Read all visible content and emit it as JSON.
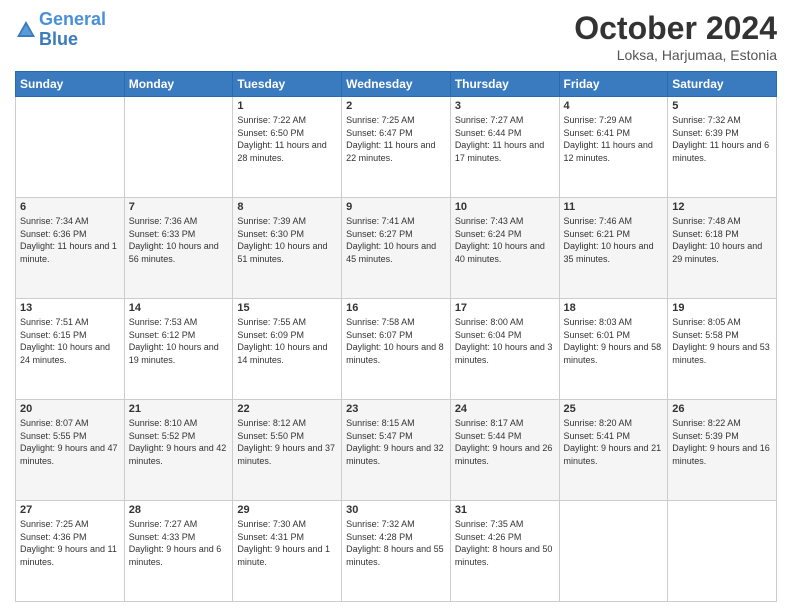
{
  "header": {
    "logo_line1": "General",
    "logo_line2": "Blue",
    "month": "October 2024",
    "location": "Loksa, Harjumaa, Estonia"
  },
  "weekdays": [
    "Sunday",
    "Monday",
    "Tuesday",
    "Wednesday",
    "Thursday",
    "Friday",
    "Saturday"
  ],
  "weeks": [
    [
      {
        "day": "",
        "content": ""
      },
      {
        "day": "",
        "content": ""
      },
      {
        "day": "1",
        "content": "Sunrise: 7:22 AM\nSunset: 6:50 PM\nDaylight: 11 hours and 28 minutes."
      },
      {
        "day": "2",
        "content": "Sunrise: 7:25 AM\nSunset: 6:47 PM\nDaylight: 11 hours and 22 minutes."
      },
      {
        "day": "3",
        "content": "Sunrise: 7:27 AM\nSunset: 6:44 PM\nDaylight: 11 hours and 17 minutes."
      },
      {
        "day": "4",
        "content": "Sunrise: 7:29 AM\nSunset: 6:41 PM\nDaylight: 11 hours and 12 minutes."
      },
      {
        "day": "5",
        "content": "Sunrise: 7:32 AM\nSunset: 6:39 PM\nDaylight: 11 hours and 6 minutes."
      }
    ],
    [
      {
        "day": "6",
        "content": "Sunrise: 7:34 AM\nSunset: 6:36 PM\nDaylight: 11 hours and 1 minute."
      },
      {
        "day": "7",
        "content": "Sunrise: 7:36 AM\nSunset: 6:33 PM\nDaylight: 10 hours and 56 minutes."
      },
      {
        "day": "8",
        "content": "Sunrise: 7:39 AM\nSunset: 6:30 PM\nDaylight: 10 hours and 51 minutes."
      },
      {
        "day": "9",
        "content": "Sunrise: 7:41 AM\nSunset: 6:27 PM\nDaylight: 10 hours and 45 minutes."
      },
      {
        "day": "10",
        "content": "Sunrise: 7:43 AM\nSunset: 6:24 PM\nDaylight: 10 hours and 40 minutes."
      },
      {
        "day": "11",
        "content": "Sunrise: 7:46 AM\nSunset: 6:21 PM\nDaylight: 10 hours and 35 minutes."
      },
      {
        "day": "12",
        "content": "Sunrise: 7:48 AM\nSunset: 6:18 PM\nDaylight: 10 hours and 29 minutes."
      }
    ],
    [
      {
        "day": "13",
        "content": "Sunrise: 7:51 AM\nSunset: 6:15 PM\nDaylight: 10 hours and 24 minutes."
      },
      {
        "day": "14",
        "content": "Sunrise: 7:53 AM\nSunset: 6:12 PM\nDaylight: 10 hours and 19 minutes."
      },
      {
        "day": "15",
        "content": "Sunrise: 7:55 AM\nSunset: 6:09 PM\nDaylight: 10 hours and 14 minutes."
      },
      {
        "day": "16",
        "content": "Sunrise: 7:58 AM\nSunset: 6:07 PM\nDaylight: 10 hours and 8 minutes."
      },
      {
        "day": "17",
        "content": "Sunrise: 8:00 AM\nSunset: 6:04 PM\nDaylight: 10 hours and 3 minutes."
      },
      {
        "day": "18",
        "content": "Sunrise: 8:03 AM\nSunset: 6:01 PM\nDaylight: 9 hours and 58 minutes."
      },
      {
        "day": "19",
        "content": "Sunrise: 8:05 AM\nSunset: 5:58 PM\nDaylight: 9 hours and 53 minutes."
      }
    ],
    [
      {
        "day": "20",
        "content": "Sunrise: 8:07 AM\nSunset: 5:55 PM\nDaylight: 9 hours and 47 minutes."
      },
      {
        "day": "21",
        "content": "Sunrise: 8:10 AM\nSunset: 5:52 PM\nDaylight: 9 hours and 42 minutes."
      },
      {
        "day": "22",
        "content": "Sunrise: 8:12 AM\nSunset: 5:50 PM\nDaylight: 9 hours and 37 minutes."
      },
      {
        "day": "23",
        "content": "Sunrise: 8:15 AM\nSunset: 5:47 PM\nDaylight: 9 hours and 32 minutes."
      },
      {
        "day": "24",
        "content": "Sunrise: 8:17 AM\nSunset: 5:44 PM\nDaylight: 9 hours and 26 minutes."
      },
      {
        "day": "25",
        "content": "Sunrise: 8:20 AM\nSunset: 5:41 PM\nDaylight: 9 hours and 21 minutes."
      },
      {
        "day": "26",
        "content": "Sunrise: 8:22 AM\nSunset: 5:39 PM\nDaylight: 9 hours and 16 minutes."
      }
    ],
    [
      {
        "day": "27",
        "content": "Sunrise: 7:25 AM\nSunset: 4:36 PM\nDaylight: 9 hours and 11 minutes."
      },
      {
        "day": "28",
        "content": "Sunrise: 7:27 AM\nSunset: 4:33 PM\nDaylight: 9 hours and 6 minutes."
      },
      {
        "day": "29",
        "content": "Sunrise: 7:30 AM\nSunset: 4:31 PM\nDaylight: 9 hours and 1 minute."
      },
      {
        "day": "30",
        "content": "Sunrise: 7:32 AM\nSunset: 4:28 PM\nDaylight: 8 hours and 55 minutes."
      },
      {
        "day": "31",
        "content": "Sunrise: 7:35 AM\nSunset: 4:26 PM\nDaylight: 8 hours and 50 minutes."
      },
      {
        "day": "",
        "content": ""
      },
      {
        "day": "",
        "content": ""
      }
    ]
  ]
}
